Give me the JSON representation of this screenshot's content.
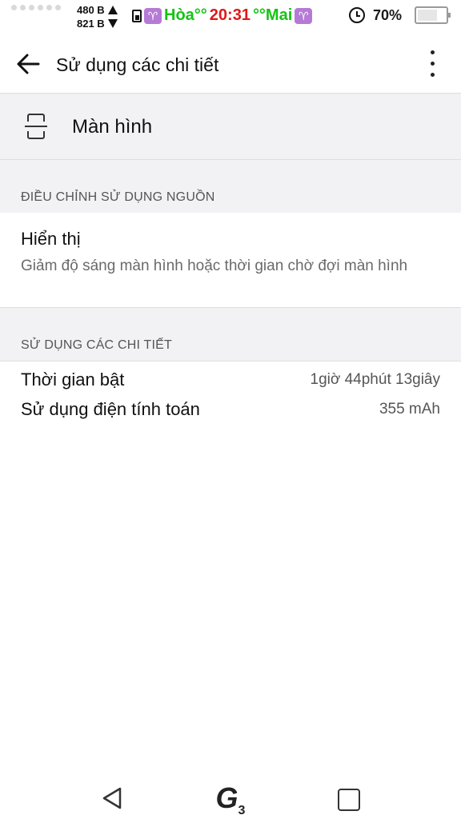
{
  "status_bar": {
    "upload_rate": "480 B",
    "download_rate": "821 B",
    "zodiac_icon_left": "♈",
    "lunar_left": "Hòa°°",
    "clock": "20:31",
    "lunar_right": "°°Mai",
    "zodiac_icon_right": "♈",
    "battery_percent": "70%",
    "battery_level": 0.7
  },
  "app_bar": {
    "title": "Sử dụng các chi tiết"
  },
  "app_header": {
    "title": "Màn hình"
  },
  "sections": {
    "power_adjust_header": "ĐIỀU CHỈNH SỬ DỤNG NGUỒN",
    "details_header": "SỬ DỤNG CÁC CHI TIẾT"
  },
  "display_item": {
    "title": "Hiển thị",
    "description": "Giảm độ sáng màn hình hoặc thời gian chờ đợi màn hình"
  },
  "details": [
    {
      "label": "Thời gian bật",
      "value": "1giờ 44phút 13giây"
    },
    {
      "label": "Sử dụng điện tính toán",
      "value": "355 mAh"
    }
  ],
  "navbar": {
    "home_logo": "G",
    "home_logo_sub": "3"
  },
  "colors": {
    "green": "#14c414",
    "red": "#e01818",
    "zodiac": "#b57ad6",
    "section_bg": "#f2f2f4"
  }
}
